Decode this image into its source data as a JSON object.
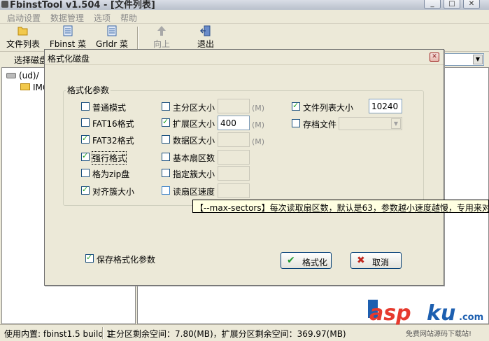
{
  "window": {
    "title": "FbinstTool v1.504 - [文件列表]",
    "min": "_",
    "max": "□",
    "close": "✕"
  },
  "menu": [
    "启动设置",
    "数据管理",
    "选项",
    "帮助"
  ],
  "toolbar": {
    "file_list": "文件列表",
    "fbinst_menu": "Fbinst 菜单",
    "grldr_menu": "Grldr 菜单",
    "up": "向上",
    "exit": "退出"
  },
  "disk_bar": {
    "label": "选择磁盘",
    "selected": ""
  },
  "tree": {
    "root": "(ud)/",
    "child": "IMG"
  },
  "status": {
    "builtin": "使用内置: fbinst1.5 build 1",
    "space": "主分区剩余空间：7.80(MB)，扩展分区剩余空间：369.97(MB)"
  },
  "dialog": {
    "title": "格式化磁盘",
    "close": "✕",
    "group": "格式化参数",
    "col1": [
      {
        "label": "普通模式",
        "checked": false
      },
      {
        "label": "FAT16格式",
        "checked": false
      },
      {
        "label": "FAT32格式",
        "checked": true
      },
      {
        "label": "强行格式",
        "checked": true
      },
      {
        "label": "格为zip盘",
        "checked": false
      },
      {
        "label": "对齐簇大小",
        "checked": true
      }
    ],
    "col2": [
      {
        "label": "主分区大小",
        "checked": false,
        "value": "",
        "unit": "(M)"
      },
      {
        "label": "扩展区大小",
        "checked": true,
        "value": "400",
        "unit": "(M)"
      },
      {
        "label": "数据区大小",
        "checked": false,
        "value": "",
        "unit": "(M)"
      },
      {
        "label": "基本扇区数",
        "checked": false,
        "value": "",
        "unit": ""
      },
      {
        "label": "指定簇大小",
        "checked": false,
        "value": "",
        "unit": ""
      },
      {
        "label": "读扇区速度",
        "checked": false,
        "value": "",
        "unit": ""
      }
    ],
    "col3": [
      {
        "label": "文件列表大小",
        "checked": true,
        "value": "10240"
      },
      {
        "label": "存档文件",
        "checked": false,
        "value": ""
      }
    ],
    "tooltip": "【--max-sectors】每次读取扇区数，默认是63，参数越小速度越慢，专用来对付",
    "save_params": {
      "label": "保存格式化参数",
      "checked": true
    },
    "ok": "格式化",
    "cancel": "取消"
  },
  "watermark": {
    "brand": "asp",
    "tld": "ku",
    "suffix": ".com",
    "sub": "免费网站源码下载站!"
  }
}
